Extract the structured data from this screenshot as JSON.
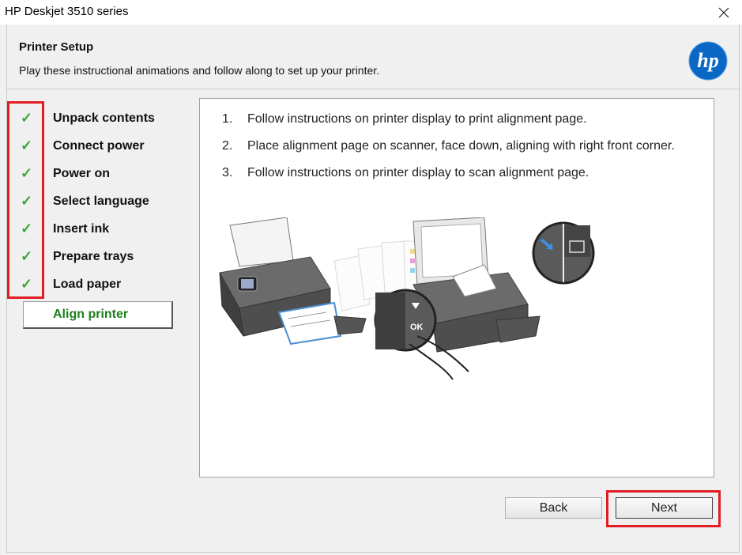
{
  "window": {
    "title": "HP Deskjet 3510 series",
    "close_icon": "close-icon"
  },
  "header": {
    "title": "Printer Setup",
    "subtitle": "Play these instructional animations and follow along to set up your printer.",
    "logo_icon": "hp-logo"
  },
  "steps": {
    "completed_mark": "✓",
    "items": [
      {
        "label": "Unpack contents",
        "done": true
      },
      {
        "label": "Connect power",
        "done": true
      },
      {
        "label": "Power on",
        "done": true
      },
      {
        "label": "Select language",
        "done": true
      },
      {
        "label": "Insert ink",
        "done": true
      },
      {
        "label": "Prepare trays",
        "done": true
      },
      {
        "label": "Load paper",
        "done": true
      }
    ],
    "current": {
      "label": "Align printer"
    }
  },
  "instructions": [
    {
      "num": "1.",
      "text": "Follow instructions on printer display to print alignment page."
    },
    {
      "num": "2.",
      "text": "Place alignment page on scanner, face down, aligning with right front corner."
    },
    {
      "num": "3.",
      "text": "Follow instructions on printer display to scan alignment page."
    }
  ],
  "illustration": {
    "ok_label": "OK"
  },
  "buttons": {
    "back": "Back",
    "next": "Next"
  },
  "colors": {
    "check": "#3aa53a",
    "current_step": "#1d7f1d",
    "highlight": "#e01e24",
    "hp_blue": "#0a68c4"
  }
}
